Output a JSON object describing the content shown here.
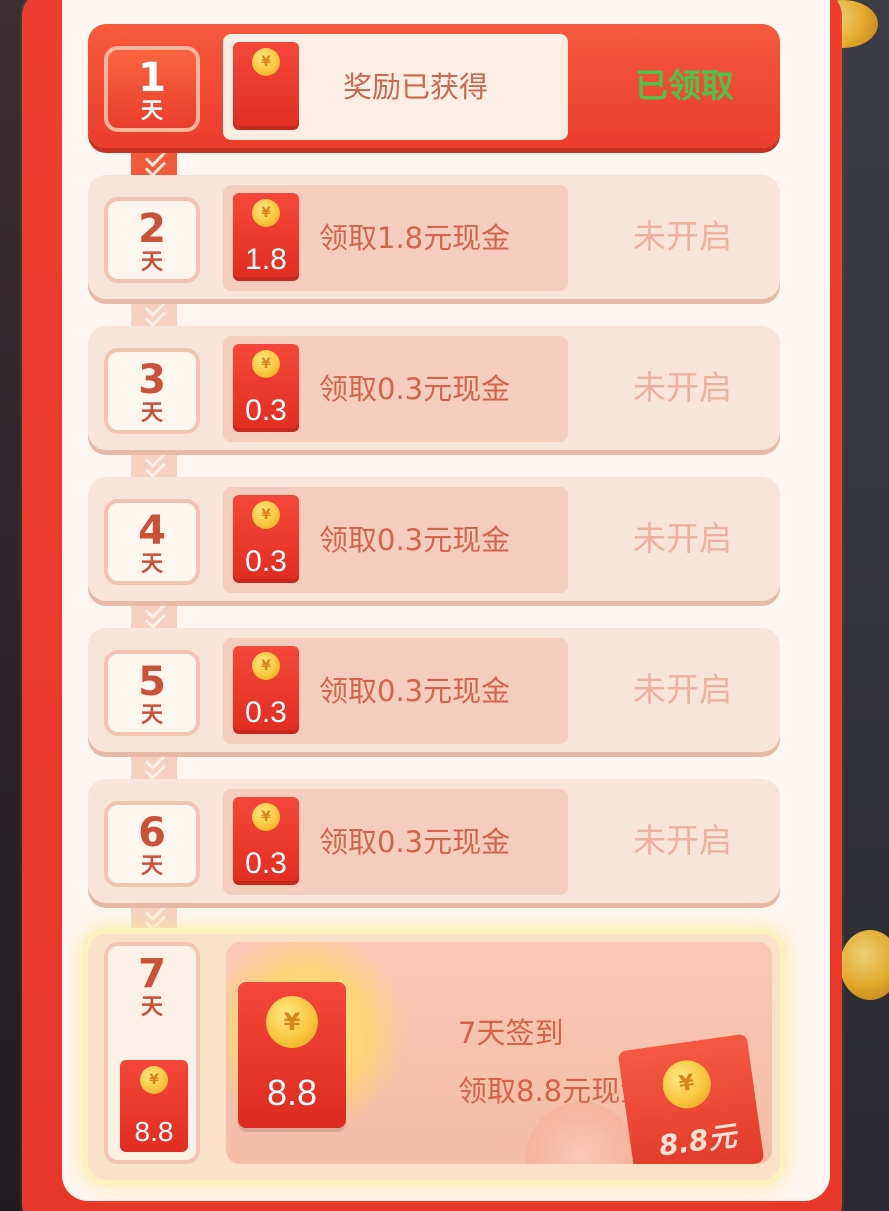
{
  "days": [
    {
      "day": "1",
      "unit": "天",
      "amount": "",
      "reward": "奖励已获得",
      "status": "已领取"
    },
    {
      "day": "2",
      "unit": "天",
      "amount": "1.8",
      "reward": "领取1.8元现金",
      "status": "未开启"
    },
    {
      "day": "3",
      "unit": "天",
      "amount": "0.3",
      "reward": "领取0.3元现金",
      "status": "未开启"
    },
    {
      "day": "4",
      "unit": "天",
      "amount": "0.3",
      "reward": "领取0.3元现金",
      "status": "未开启"
    },
    {
      "day": "5",
      "unit": "天",
      "amount": "0.3",
      "reward": "领取0.3元现金",
      "status": "未开启"
    },
    {
      "day": "6",
      "unit": "天",
      "amount": "0.3",
      "reward": "领取0.3元现金",
      "status": "未开启"
    }
  ],
  "final_day": {
    "day": "7",
    "unit": "天",
    "small_amount": "8.8",
    "big_amount": "8.8",
    "title": "7天签到",
    "reward": "领取8.8元现金",
    "deco_label": "8.8元"
  },
  "coin_symbol": "¥",
  "colors": {
    "panel_red": "#ef3e2e",
    "claimed_green": "#4ec247",
    "locked_text": "#edb29d"
  }
}
